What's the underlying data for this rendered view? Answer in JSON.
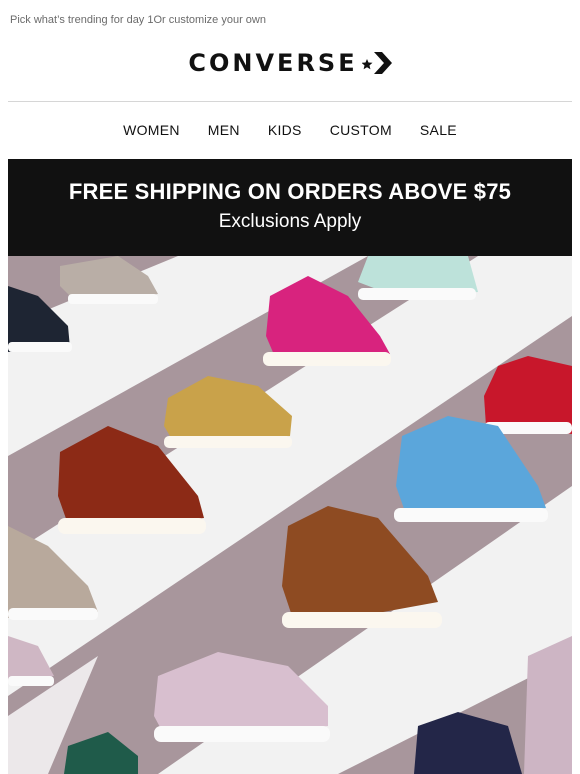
{
  "preheader": "Pick what’s trending for day 1Or customize your own",
  "brand": {
    "name": "CONVERSE",
    "logo_icon": "star-chevron-icon"
  },
  "nav": [
    "WOMEN",
    "MEN",
    "KIDS",
    "CUSTOM",
    "SALE"
  ],
  "banner": {
    "title": "FREE SHIPPING ON ORDERS ABOVE $75",
    "subtitle": "Exclusions Apply"
  },
  "hero": {
    "alt": "Assorted colored Chuck Taylor sneakers",
    "background": "#a8969c",
    "stripe": "#f2f2f2"
  },
  "colors": {
    "banner_bg": "#111111",
    "text": "#111111"
  }
}
